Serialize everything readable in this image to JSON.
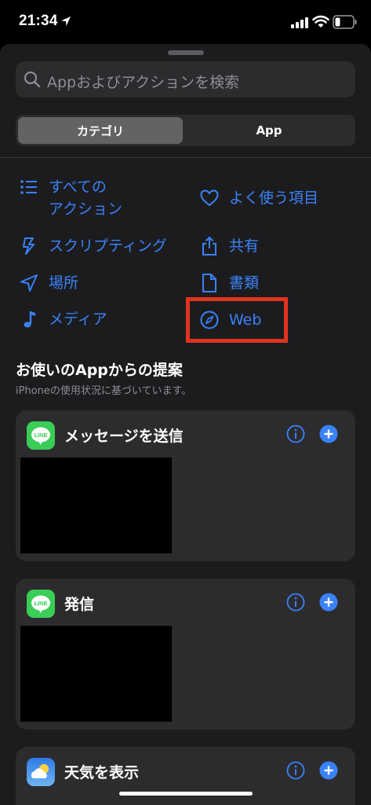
{
  "status_bar": {
    "time": "21:34"
  },
  "search": {
    "placeholder": "Appおよびアクションを検索"
  },
  "segments": {
    "selected": "カテゴリ",
    "other": "App"
  },
  "categories": [
    {
      "label": "すべての\nアクション",
      "icon": "list-icon"
    },
    {
      "label": "よく使う項目",
      "icon": "heart-icon"
    },
    {
      "label": "スクリプティング",
      "icon": "scripting-icon"
    },
    {
      "label": "共有",
      "icon": "share-icon"
    },
    {
      "label": "場所",
      "icon": "location-arrow-icon"
    },
    {
      "label": "書類",
      "icon": "document-icon"
    },
    {
      "label": "メディア",
      "icon": "music-note-icon"
    },
    {
      "label": "Web",
      "icon": "compass-icon"
    }
  ],
  "suggestions": {
    "title": "お使いのAppからの提案",
    "subtitle": "iPhoneの使用状況に基づいています。",
    "cards": [
      {
        "title": "メッセージを送信",
        "app_icon": "line-app-icon",
        "app_icon_text": "LINE"
      },
      {
        "title": "発信",
        "app_icon": "line-app-icon",
        "app_icon_text": "LINE"
      },
      {
        "title": "天気を表示",
        "app_icon": "weather-app-icon"
      }
    ]
  },
  "colors": {
    "accent": "#3a82f7",
    "sheet_background": "#1c1c1e",
    "card_background": "#2c2c2e",
    "highlight": "#e0341e",
    "line_green": "#3acd57"
  }
}
